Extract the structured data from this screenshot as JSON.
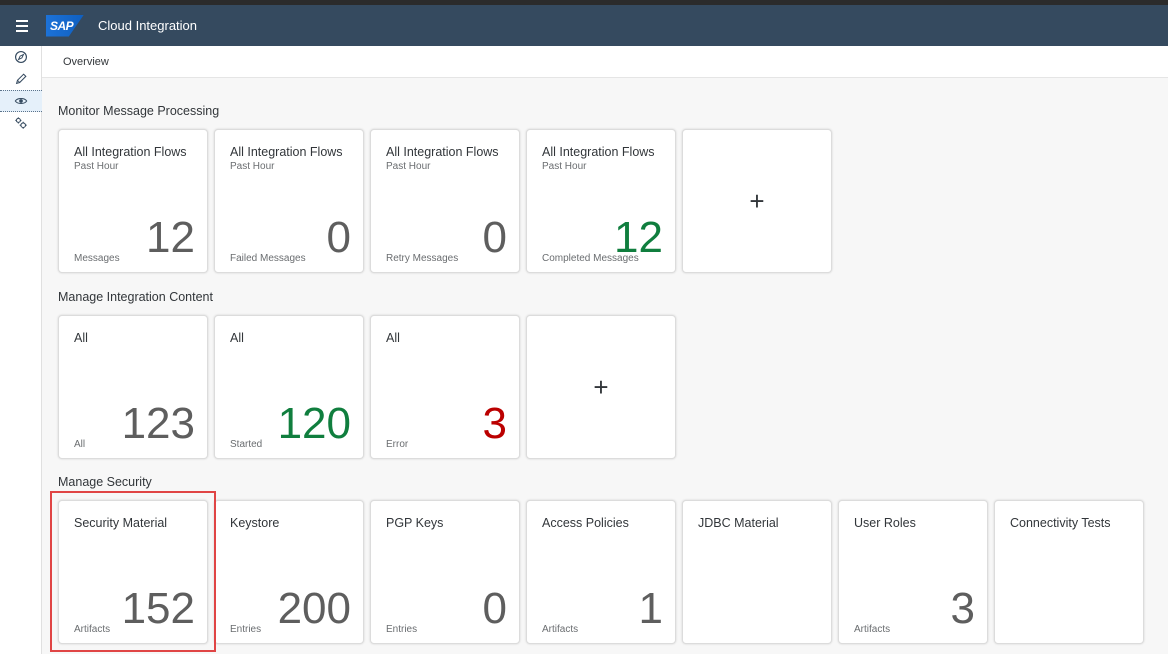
{
  "shell": {
    "logo_text": "SAP",
    "app_title": "Cloud Integration"
  },
  "sidenav": {
    "items": [
      {
        "icon": "compass-icon",
        "label": "Discover"
      },
      {
        "icon": "pencil-icon",
        "label": "Design"
      },
      {
        "icon": "eye-icon",
        "label": "Monitor",
        "selected": true
      },
      {
        "icon": "settings-icon",
        "label": "Settings"
      }
    ]
  },
  "breadcrumb": "Overview",
  "groups": [
    {
      "title": "Monitor Message Processing",
      "tiles": [
        {
          "title": "All Integration Flows",
          "subtitle": "Past Hour",
          "value": "12",
          "footer": "Messages",
          "color": "#5e5e5e"
        },
        {
          "title": "All Integration Flows",
          "subtitle": "Past Hour",
          "value": "0",
          "footer": "Failed Messages",
          "color": "#5e5e5e"
        },
        {
          "title": "All Integration Flows",
          "subtitle": "Past Hour",
          "value": "0",
          "footer": "Retry Messages",
          "color": "#5e5e5e"
        },
        {
          "title": "All Integration Flows",
          "subtitle": "Past Hour",
          "value": "12",
          "footer": "Completed Messages",
          "color": "#107e3e"
        },
        {
          "add": true,
          "label": "+"
        }
      ]
    },
    {
      "title": "Manage Integration Content",
      "tiles": [
        {
          "title": "All",
          "value": "123",
          "footer": "All",
          "color": "#5e5e5e"
        },
        {
          "title": "All",
          "value": "120",
          "footer": "Started",
          "color": "#107e3e"
        },
        {
          "title": "All",
          "value": "3",
          "footer": "Error",
          "color": "#bb0000"
        },
        {
          "add": true,
          "label": "+"
        }
      ]
    },
    {
      "title": "Manage Security",
      "tiles": [
        {
          "title": "Security Material",
          "value": "152",
          "footer": "Artifacts",
          "color": "#5e5e5e",
          "highlighted": true
        },
        {
          "title": "Keystore",
          "value": "200",
          "footer": "Entries",
          "color": "#5e5e5e"
        },
        {
          "title": "PGP Keys",
          "value": "0",
          "footer": "Entries",
          "color": "#5e5e5e"
        },
        {
          "title": "Access Policies",
          "value": "1",
          "footer": "Artifacts",
          "color": "#5e5e5e"
        },
        {
          "title": "JDBC Material",
          "value": "",
          "footer": "",
          "color": "#5e5e5e"
        },
        {
          "title": "User Roles",
          "value": "3",
          "footer": "Artifacts",
          "color": "#5e5e5e"
        },
        {
          "title": "Connectivity Tests",
          "value": "",
          "footer": "",
          "color": "#5e5e5e"
        }
      ]
    }
  ],
  "colors": {
    "shell_bg": "#354a5f",
    "positive": "#107e3e",
    "negative": "#bb0000",
    "highlight_border": "#e04545"
  }
}
